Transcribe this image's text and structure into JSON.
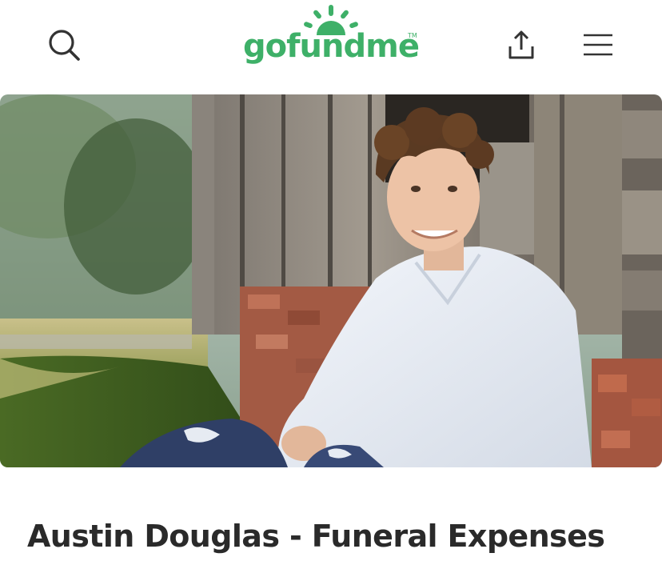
{
  "header": {
    "logo_text": "gofundme",
    "logo_tm": "TM",
    "search_icon": "search-icon",
    "share_icon": "share-icon",
    "menu_icon": "hamburger-menu-icon"
  },
  "campaign": {
    "title": "Austin Douglas - Funeral Expenses",
    "hero_image": "photo of smiling young man with curly hair in white plaid shirt sitting against old wooden barn wall"
  },
  "colors": {
    "brand_green": "#3eb068",
    "title_text": "#2a2a2a",
    "icon": "#333333"
  }
}
